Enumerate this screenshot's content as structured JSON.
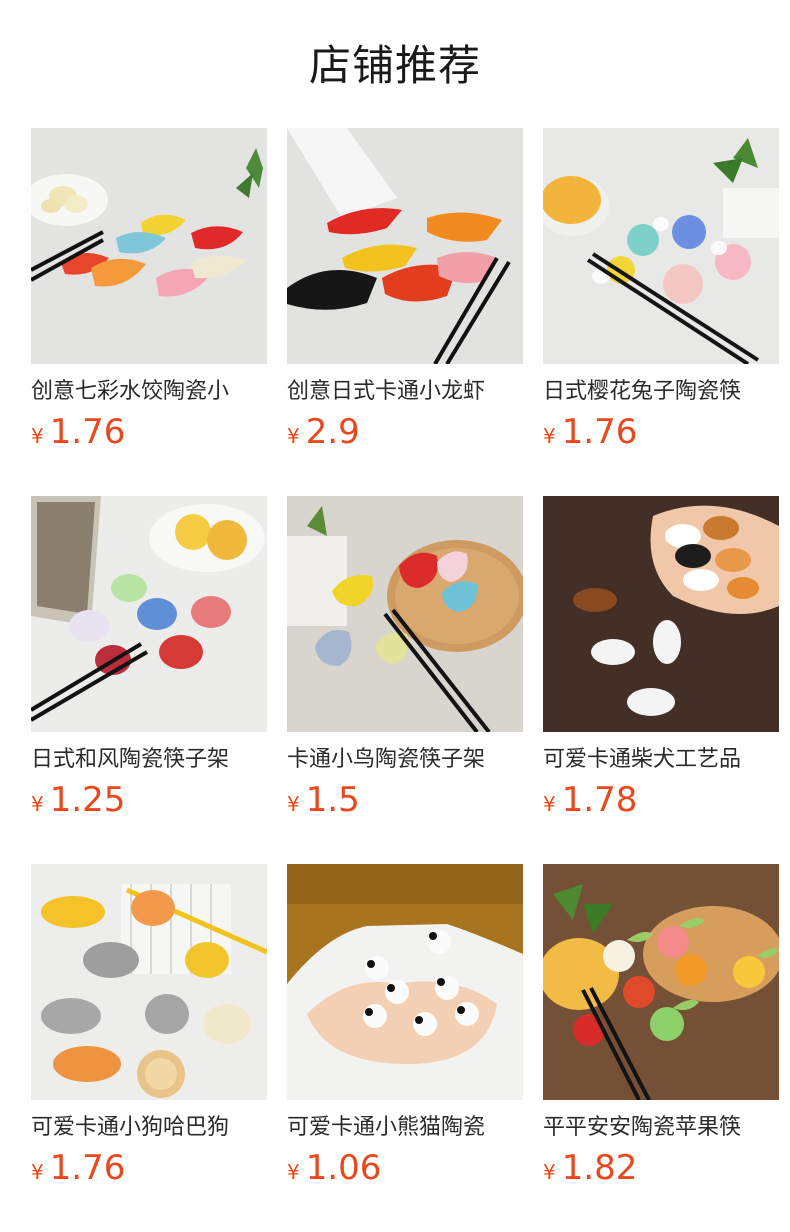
{
  "header": {
    "title": "店铺推荐"
  },
  "products": [
    {
      "name": "创意七彩水饺陶瓷小",
      "currency": "¥",
      "price": "1.76",
      "image": "dumpling-chopstick-rests"
    },
    {
      "name": "创意日式卡通小龙虾",
      "currency": "¥",
      "price": "2.9",
      "image": "crayfish-chopstick-rests"
    },
    {
      "name": "日式樱花兔子陶瓷筷",
      "currency": "¥",
      "price": "1.76",
      "image": "sakura-rabbit-chopstick-rests"
    },
    {
      "name": "日式和风陶瓷筷子架",
      "currency": "¥",
      "price": "1.25",
      "image": "japanese-pattern-chopstick-rests"
    },
    {
      "name": "卡通小鸟陶瓷筷子架",
      "currency": "¥",
      "price": "1.5",
      "image": "bird-chopstick-rests"
    },
    {
      "name": "可爱卡通柴犬工艺品",
      "currency": "¥",
      "price": "1.78",
      "image": "shiba-dog-chopstick-rests"
    },
    {
      "name": "可爱卡通小狗哈巴狗",
      "currency": "¥",
      "price": "1.76",
      "image": "puppy-chopstick-rests"
    },
    {
      "name": "可爱卡通小熊猫陶瓷",
      "currency": "¥",
      "price": "1.06",
      "image": "panda-chopstick-rests"
    },
    {
      "name": "平平安安陶瓷苹果筷",
      "currency": "¥",
      "price": "1.82",
      "image": "apple-chopstick-rests"
    }
  ],
  "colors": {
    "price": "#e8481c",
    "title": "#1a1a1a"
  }
}
